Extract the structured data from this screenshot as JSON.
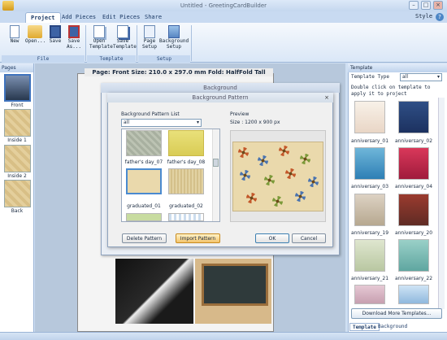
{
  "window": {
    "title": "Untitled - GreetingCardBuilder",
    "style_menu": "Style"
  },
  "ribbon": {
    "tabs": [
      "Project",
      "Add Pieces",
      "Edit Pieces",
      "Share"
    ],
    "buttons": [
      {
        "label": "New",
        "icon": "new-doc-icon"
      },
      {
        "label": "Open...",
        "icon": "folder-icon"
      },
      {
        "label": "Save",
        "icon": "save-icon"
      },
      {
        "label": "Save As...",
        "icon": "save-as-icon"
      },
      {
        "label": "Open Template",
        "icon": "open-template-icon"
      },
      {
        "label": "Save Template",
        "icon": "save-template-icon"
      },
      {
        "label": "Page Setup",
        "icon": "page-setup-icon"
      },
      {
        "label": "Background Setup",
        "icon": "background-setup-icon"
      }
    ],
    "groups": [
      "File",
      "Template",
      "Setup"
    ]
  },
  "pages": {
    "title": "Pages",
    "items": [
      "Front",
      "Inside 1",
      "Inside 2",
      "Back"
    ]
  },
  "document": {
    "caption": "Page: Front  Size: 210.0 x 297.0 mm  Fold: HalfFold Tall"
  },
  "template_panel": {
    "title": "Template",
    "type_label": "Template Type",
    "type_value": "all",
    "hint": "Double click on template to apply it to project",
    "items": [
      "anniversary_01",
      "anniversary_02",
      "anniversary_03",
      "anniversary_04",
      "anniversary_19",
      "anniversary_20",
      "anniversary_21",
      "anniversary_22"
    ],
    "download_button": "Download More Templates...",
    "bottom_tabs": [
      "Template",
      "Background"
    ]
  },
  "background_dialog": {
    "title": "Background"
  },
  "pattern_dialog": {
    "title": "Background Pattern",
    "list_label": "Background Pattern List",
    "filter_value": "all",
    "items": [
      "father's day_07",
      "father's day_08",
      "graduated_01",
      "graduated_02"
    ],
    "preview_label": "Preview",
    "preview_size": "Size : 1200 x 900 px",
    "buttons": {
      "delete": "Delete Pattern",
      "import": "Import Pattern",
      "ok": "OK",
      "cancel": "Cancel"
    }
  }
}
